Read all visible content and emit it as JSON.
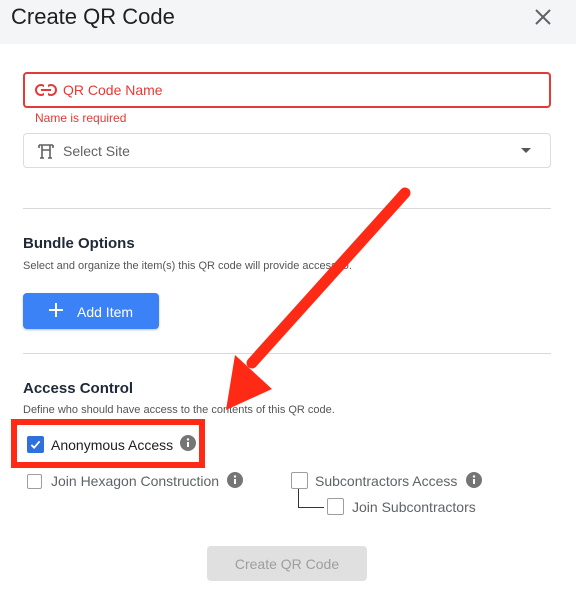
{
  "dialog": {
    "title": "Create QR Code",
    "close_icon": "close-icon"
  },
  "form": {
    "name_placeholder": "QR Code Name",
    "name_value": "",
    "name_error": "Name is required",
    "site_placeholder": "Select Site",
    "link_icon": "link-icon",
    "site_icon": "site-crane-icon"
  },
  "bundle": {
    "title": "Bundle Options",
    "description": "Select and organize the item(s) this QR code will provide access to.",
    "add_item_label": "Add Item"
  },
  "access": {
    "title": "Access Control",
    "description": "Define who should have access to the contents of this QR code.",
    "anonymous": {
      "label": "Anonymous Access",
      "checked": true
    },
    "join_company": {
      "label": "Join Hexagon Construction",
      "checked": false
    },
    "subcontractors": {
      "label": "Subcontractors Access",
      "checked": false
    },
    "join_subcontractors": {
      "label": "Join Subcontractors",
      "checked": false
    }
  },
  "footer": {
    "create_label": "Create QR Code"
  },
  "colors": {
    "error": "#e53935",
    "primary": "#3b82f6",
    "annotation": "#ff2a16"
  }
}
